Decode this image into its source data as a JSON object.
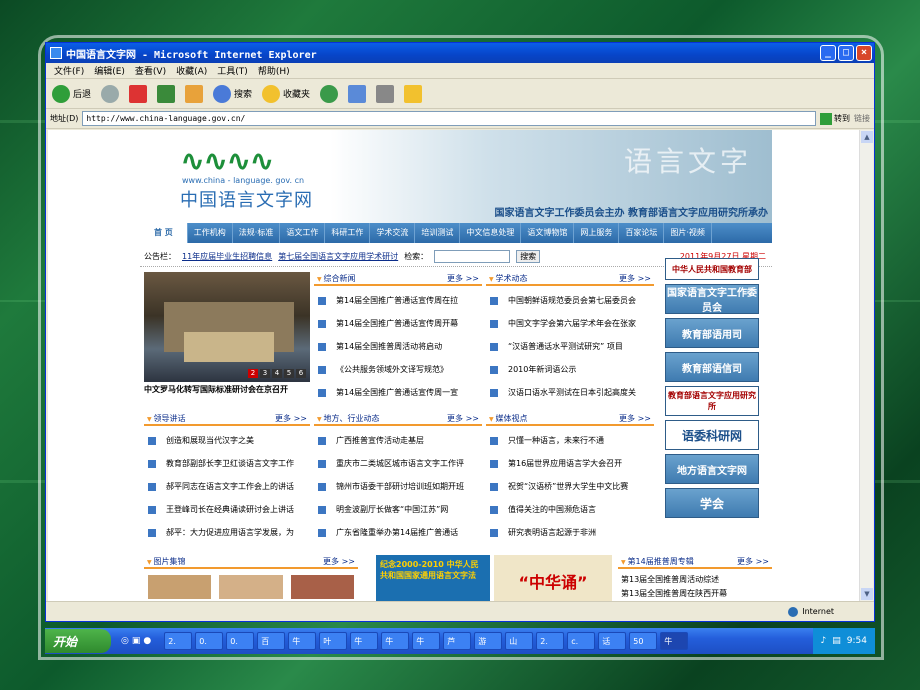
{
  "window": {
    "title": "中国语言文字网 - Microsoft Internet Explorer"
  },
  "menu": [
    "文件(F)",
    "编辑(E)",
    "查看(V)",
    "收藏(A)",
    "工具(T)",
    "帮助(H)"
  ],
  "toolbar": {
    "back": "后退",
    "search": "搜索",
    "favorites": "收藏夹"
  },
  "address": {
    "label": "地址(D)",
    "url": "http://www.china-language.gov.cn/",
    "go": "转到",
    "links": "链接"
  },
  "site": {
    "logo_url": "www.china - language. gov. cn",
    "logo_name": "中国语言文字网",
    "banner_sub": "国家语言文字工作委员会主办   教育部语言文字应用研究所承办",
    "banner_deco": "语言文字",
    "nav": [
      "首 页",
      "工作机构",
      "法规·标准",
      "语文工作",
      "科研工作",
      "学术交流",
      "培训测试",
      "中文信息处理",
      "语文博物馆",
      "网上服务",
      "百家论坛",
      "图片·视频"
    ],
    "notice": {
      "label": "公告栏：",
      "link1": "11年应届毕业生招聘信息",
      "link2": "第七届全国语言文字应用学术研讨",
      "search_label": "检索：",
      "search_btn": "搜索",
      "date": "2011年9月27日 星期二"
    },
    "photo_caption": "中文罗马化转写国际标准研讨会在京召开",
    "photo_nums": [
      "2",
      "3",
      "4",
      "5",
      "6"
    ],
    "more": "更多 >>",
    "news": {
      "title": "综合新闻",
      "items": [
        "第14届全国推广普通话宣传周在拉",
        "第14届全国推广普通话宣传周开幕",
        "第14届全国推普周活动将启动",
        "《公共服务领域外文译写规范》",
        "第14届全国推广普通话宣传周一宣"
      ]
    },
    "academic": {
      "title": "学术动态",
      "items": [
        "中国朝鲜语规范委员会第七届委员会",
        "中国文字学会第六届学术年会在张家",
        "“汉语普通话水平测试研究” 项目",
        "2010年新词语公示",
        "汉语口语水平测试在日本引起高度关"
      ]
    },
    "leaders": {
      "title": "领导讲话",
      "items": [
        "创造和展现当代汉字之美",
        "教育部副部长李卫红谈语言文字工作",
        "郝平同志在语言文字工作会上的讲话",
        "王登峰司长在经典诵读研讨会上讲话",
        "郝平：大力促进应用语言学发展，为"
      ]
    },
    "local": {
      "title": "地方、行业动态",
      "items": [
        "广西推普宣传活动走基层",
        "重庆市二类城区城市语言文字工作评",
        "锦州市语委干部研讨培训班如期开班",
        "明金波副厅长做客“中国江苏”网",
        "广东省隆重举办第14届推广普通话"
      ]
    },
    "media": {
      "title": "媒体视点",
      "items": [
        "只懂一种语言，未来行不通",
        "第16届世界应用语言学大会召开",
        "祝贺“汉语桥”世界大学生中文比赛",
        "值得关注的中国濒危语言",
        "研究表明语言起源于非洲"
      ]
    },
    "pictures": {
      "title": "图片集锦"
    },
    "promo": {
      "title": "第14届推普周专辑",
      "items": [
        "第13届全国推普周活动综述",
        "第13届全国推普周在陕西开幕"
      ]
    },
    "banners": {
      "b1": "纪念2000-2010 中华人民共和国国家通用语言文字法",
      "b2": "“中华诵”"
    },
    "sidebar": [
      "中华人民共和国教育部",
      "国家语言文字工作委员会",
      "教育部语用司",
      "教育部语信司",
      "教育部语言文字应用研究所",
      "语委科研网",
      "地方语言文字网",
      "学会"
    ]
  },
  "status": {
    "zone": "Internet"
  },
  "taskbar": {
    "start": "开始",
    "time": "9:54",
    "tasks": [
      "2.",
      "0.",
      "0.",
      "百",
      "牛",
      "叶",
      "牛",
      "牛",
      "牛",
      "芦",
      "游",
      "山",
      "2.",
      "c.",
      "话",
      "50",
      "牛"
    ]
  }
}
